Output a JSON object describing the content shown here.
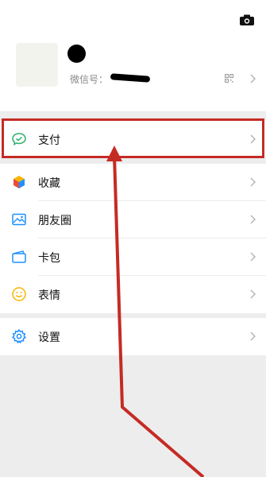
{
  "profile": {
    "wechat_id_label": "微信号：",
    "icons": {
      "camera": "camera-icon",
      "qr": "qr-code-icon",
      "chevron": "chevron-right-icon"
    }
  },
  "menu": {
    "pay": {
      "label": "支付",
      "icon": "wechat-pay-icon"
    },
    "favorites": {
      "label": "收藏",
      "icon": "favorites-cube-icon"
    },
    "moments": {
      "label": "朋友圈",
      "icon": "moments-picture-icon"
    },
    "cards": {
      "label": "卡包",
      "icon": "card-wallet-icon"
    },
    "stickers": {
      "label": "表情",
      "icon": "smiley-icon"
    },
    "settings": {
      "label": "设置",
      "icon": "gear-icon"
    }
  },
  "colors": {
    "annotation": "#c42b24",
    "background": "#ededed",
    "pay_green": "#2aae67",
    "icon_blue": "#1e90ff"
  }
}
